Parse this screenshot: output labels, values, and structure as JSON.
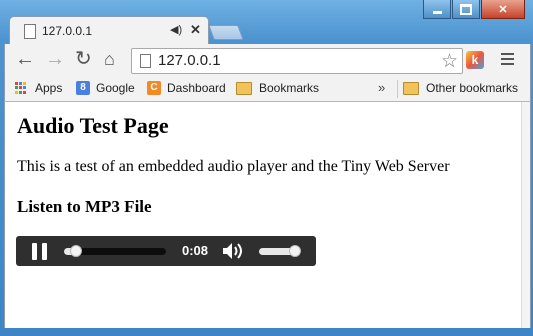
{
  "browser": {
    "tab": {
      "title": "127.0.0.1"
    },
    "omnibox": {
      "url": "127.0.0.1"
    },
    "bookmarks": {
      "items": [
        {
          "label": "Apps"
        },
        {
          "label": "Google"
        },
        {
          "label": "Dashboard"
        },
        {
          "label": "Bookmarks"
        }
      ],
      "overflow": "»",
      "other": "Other bookmarks"
    },
    "extension_label": "k"
  },
  "page": {
    "heading": "Audio Test Page",
    "intro": "This is a test of an embedded audio player and the Tiny Web Server",
    "subheading": "Listen to MP3 File"
  },
  "audio_player": {
    "state": "playing",
    "time": "0:08",
    "progress": 0.12,
    "volume": 1.0
  },
  "colors": {
    "frame": "#4d93cf",
    "player_bg": "#2f2f2f",
    "google_blue": "#4a7fe0",
    "dashboard_orange": "#f08a24"
  }
}
